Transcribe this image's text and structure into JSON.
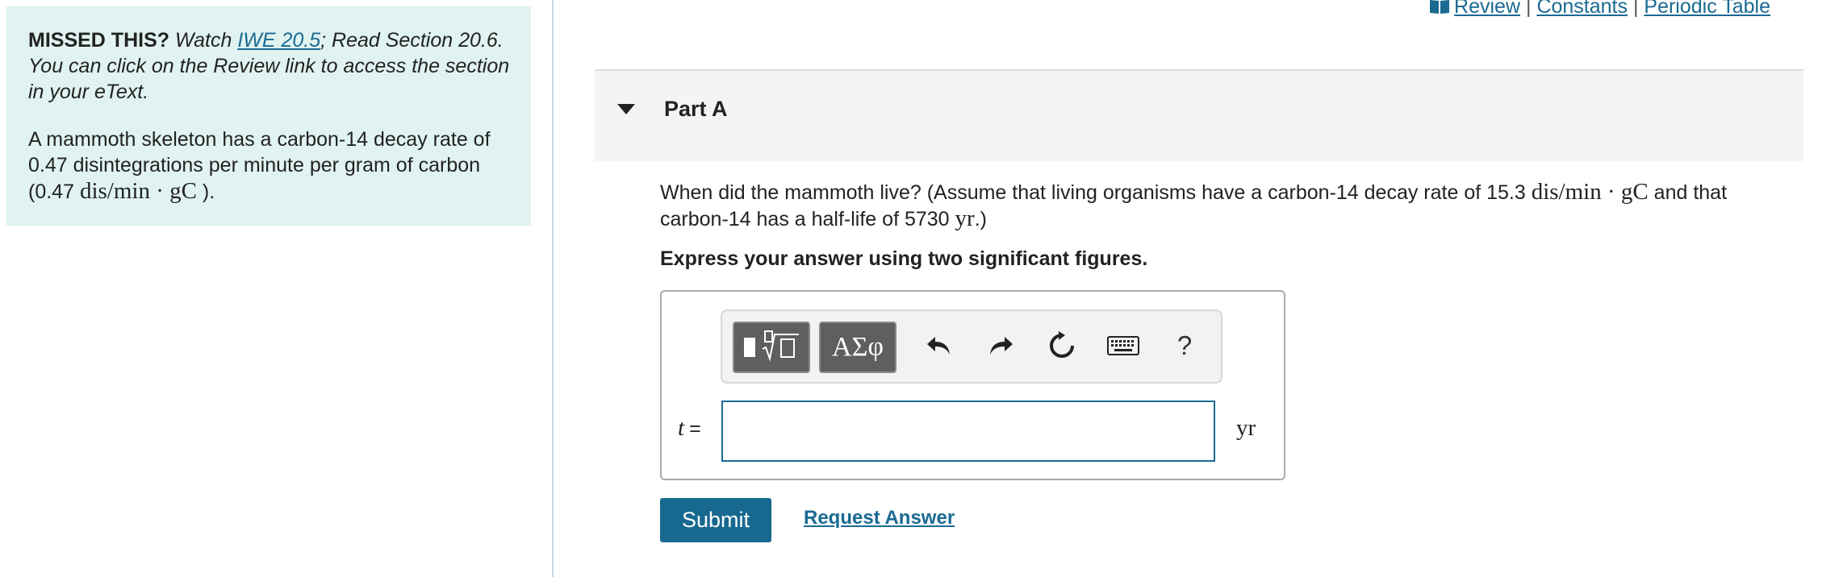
{
  "left_panel": {
    "missed_label": "MISSED THIS?",
    "watch_text": "Watch",
    "iwe_link": "IWE 20.5",
    "read_text": "; Read Section 20.6. You can click on the Review link to access the section in your eText.",
    "problem_text_1": "A mammoth skeleton has a carbon-14 decay rate of 0.47 disintegrations per minute per gram of carbon (0.47 ",
    "problem_math": "dis/min · gC",
    "problem_text_2": " )."
  },
  "top_links": {
    "review": "Review",
    "sep1": "|",
    "constants": "Constants",
    "sep2": "|",
    "periodic_table": "Periodic Table"
  },
  "part": {
    "title": "Part A"
  },
  "question": {
    "text_1": "When did the mammoth live? (Assume that living organisms have a carbon-14 decay rate of 15.3 ",
    "math_1": "dis/min · gC",
    "text_2": " and that carbon-14 has a half-life of 5730 ",
    "math_2": "yr",
    "text_3": ".)"
  },
  "instruction": "Express your answer using two significant figures.",
  "answer": {
    "toolbar": {
      "templates_icon": "templates-icon",
      "greek_label": "ΑΣφ",
      "undo_icon": "undo-icon",
      "redo_icon": "redo-icon",
      "reset_icon": "reset-icon",
      "keyboard_icon": "keyboard-icon",
      "help_label": "?"
    },
    "variable": "t",
    "equals": "=",
    "input_value": "",
    "unit": "yr"
  },
  "buttons": {
    "submit": "Submit",
    "request_answer": "Request Answer"
  },
  "colors": {
    "panel_bg": "#e0f3f1",
    "link": "#1a6a93",
    "submit_bg": "#18698f",
    "toolbar_button": "#5f5f5f"
  }
}
